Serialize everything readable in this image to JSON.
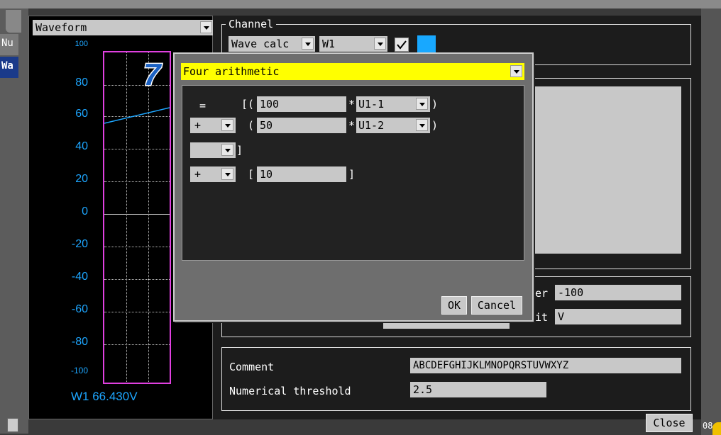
{
  "left_tabs": [
    {
      "label": "Nu"
    },
    {
      "label": "Wa"
    }
  ],
  "graph": {
    "select_value": "Waveform",
    "y_ticks": [
      "100",
      "80",
      "60",
      "40",
      "20",
      "0",
      "-20",
      "-40",
      "-60",
      "-80",
      "-100"
    ],
    "readout": "W1 66.430V",
    "accent": "#1da6ff",
    "frame_color": "#e040e0"
  },
  "channel": {
    "legend": "Channel",
    "type_value": "Wave calc",
    "ch_value": "W1",
    "checked": true,
    "color": "#18a8ff"
  },
  "step_badge": "7",
  "dialog": {
    "op_value": "Four arithmetic",
    "row1": {
      "eq": "=",
      "bracket": "[(",
      "coef": "100",
      "mul": "*",
      "src": "U1-1",
      "close": ")"
    },
    "row2": {
      "op": "+",
      "bracket": "(",
      "coef": "50",
      "mul": "*",
      "src": "U1-2",
      "close": ")"
    },
    "row3": {
      "op": "",
      "close": "]"
    },
    "row4": {
      "op": "+",
      "bracket": "[",
      "coef": "10",
      "close": "]"
    },
    "ok": "OK",
    "cancel": "Cancel"
  },
  "scale": {
    "lower_label": "er",
    "lower_value": "-100",
    "unit_label": "it",
    "unit_value": "V"
  },
  "comment": {
    "label": "Comment",
    "value": "ABCDEFGHIJKLMNOPQRSTUVWXYZ"
  },
  "threshold": {
    "label": "Numerical threshold",
    "value": "2.5"
  },
  "close_button": "Close",
  "corner_text": "08"
}
